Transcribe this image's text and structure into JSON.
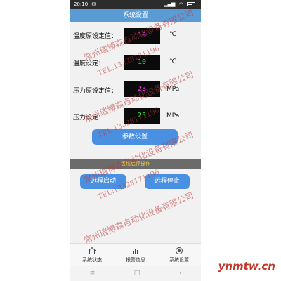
{
  "status_bar": {
    "time": "20:10",
    "carrier_icon": "message-icon"
  },
  "title": "系统设置",
  "settings": [
    {
      "label": "温度原设定值：",
      "value": "10",
      "unit": "℃",
      "color": "#e040e0"
    },
    {
      "label": "温度设定：",
      "value": "10",
      "unit": "℃",
      "color": "#2ee045"
    },
    {
      "label": "压力原设定值：",
      "value": "23",
      "unit": "MPa",
      "color": "#e040e0"
    },
    {
      "label": "压力设定：",
      "value": "23",
      "unit": "MPa",
      "color": "#2ee045"
    }
  ],
  "buttons": {
    "params": "参数设置",
    "remote_start": "远程启动",
    "remote_stop": "远程停止"
  },
  "section_title": "远程启停操作",
  "tabs": [
    {
      "label": "系统状态",
      "icon": "home-icon"
    },
    {
      "label": "报警信息",
      "icon": "bar-chart-icon"
    },
    {
      "label": "系统设置",
      "icon": "settings-icon"
    }
  ],
  "nav": {
    "menu": "≡",
    "home": "□",
    "back": "‹"
  },
  "watermark": {
    "company": "常州瑞博森自动化设备有限公司",
    "phone": "TEL:13328171196"
  },
  "site_mark": "ynmtw.cn",
  "colors": {
    "title_bar": "#5b9bd5",
    "button": "#4a90e2",
    "section_bar": "#6b6b6b",
    "section_text": "#e8d44c"
  }
}
